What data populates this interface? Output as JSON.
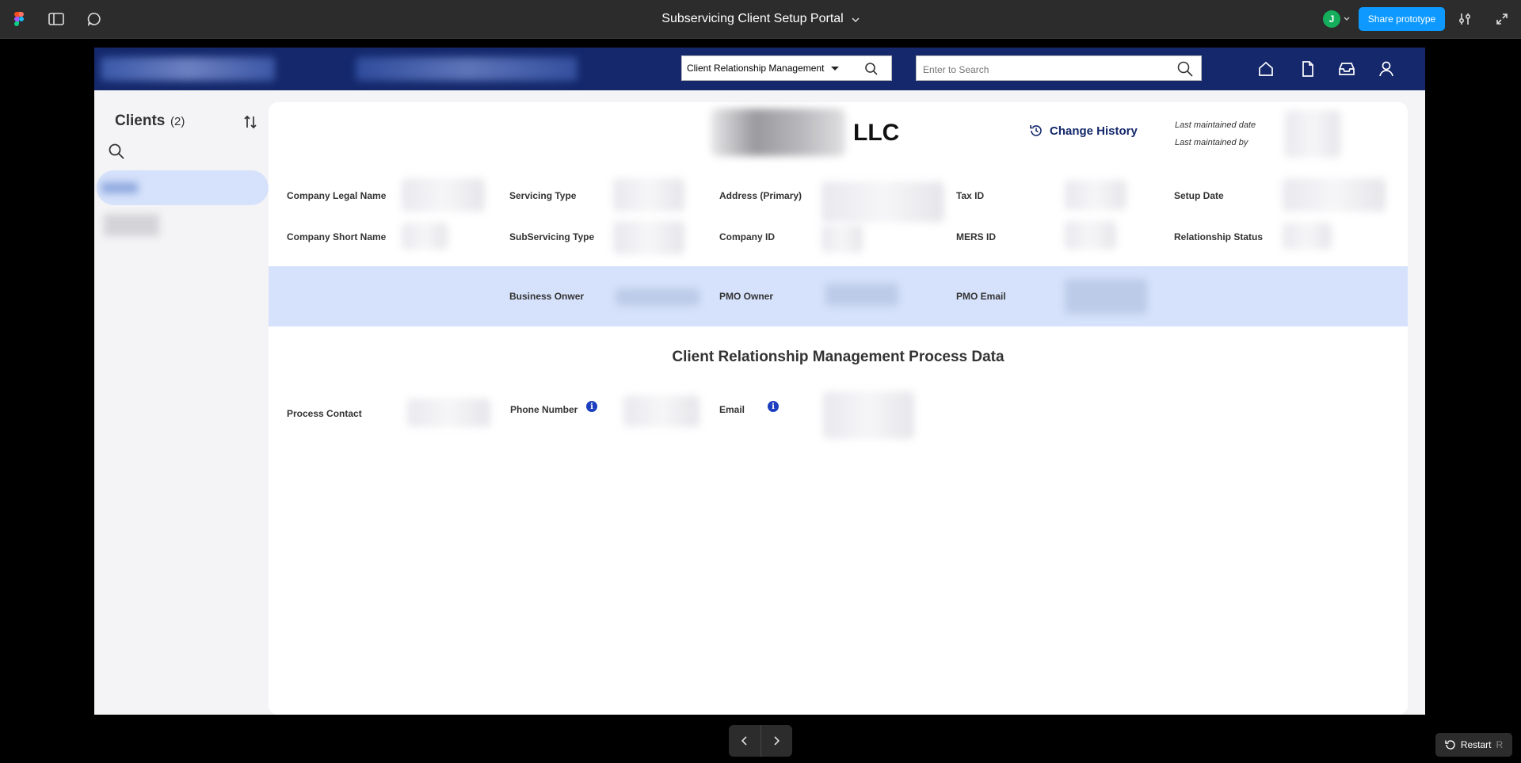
{
  "figma": {
    "title": "Subservicing Client Setup Portal",
    "avatar_initial": "J",
    "share_label": "Share prototype",
    "restart_label": "Restart",
    "restart_shortcut": "R"
  },
  "header": {
    "module_select": "Client Relationship Management",
    "search_placeholder": "Enter to Search"
  },
  "sidebar": {
    "title": "Clients",
    "count": "(2)"
  },
  "detail": {
    "company_suffix": "LLC",
    "change_history": "Change History",
    "last_maintained_date": "Last maintained date",
    "last_maintained_by": "Last maintained by",
    "fields": {
      "company_legal_name": "Company Legal Name",
      "company_short_name": "Company Short Name",
      "servicing_type": "Servicing Type",
      "subservicing_type": "SubServicing Type",
      "address_primary": "Address (Primary)",
      "company_id": "Company ID",
      "tax_id": "Tax ID",
      "mers_id": "MERS ID",
      "setup_date": "Setup Date",
      "relationship_status": "Relationship Status"
    },
    "owners": {
      "business_owner": "Business Onwer",
      "pmo_owner": "PMO Owner",
      "pmo_email": "PMO Email"
    },
    "process_section_title": "Client Relationship Management Process Data",
    "process": {
      "process_contact": "Process Contact",
      "phone_number": "Phone Number",
      "email": "Email",
      "info_glyph": "i"
    }
  }
}
